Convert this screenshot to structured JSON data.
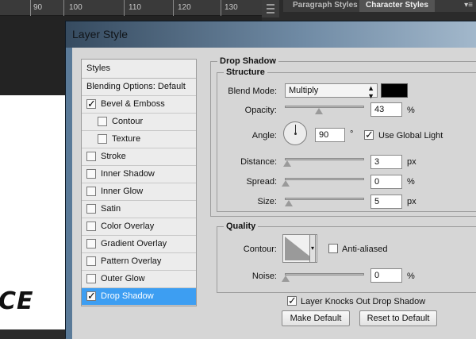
{
  "workspace": {
    "ruler_numbers": [
      "90",
      "100",
      "110",
      "120",
      "130"
    ],
    "canvas_text": "CE"
  },
  "panel": {
    "tabs": [
      "Paragraph Styles",
      "Character Styles"
    ],
    "active_tab": "Character Styles",
    "menu_icon": "panel-menu-icon"
  },
  "dialog": {
    "title": "Layer Style",
    "styles_header": "Styles",
    "blending_options": "Blending Options: Default",
    "items": [
      {
        "label": "Bevel & Emboss",
        "checked": true
      },
      {
        "label": "Contour",
        "checked": false,
        "indent": true
      },
      {
        "label": "Texture",
        "checked": false,
        "indent": true
      },
      {
        "label": "Stroke",
        "checked": false
      },
      {
        "label": "Inner Shadow",
        "checked": false
      },
      {
        "label": "Inner Glow",
        "checked": false
      },
      {
        "label": "Satin",
        "checked": false
      },
      {
        "label": "Color Overlay",
        "checked": false
      },
      {
        "label": "Gradient Overlay",
        "checked": false
      },
      {
        "label": "Pattern Overlay",
        "checked": false
      },
      {
        "label": "Outer Glow",
        "checked": false
      },
      {
        "label": "Drop Shadow",
        "checked": true,
        "selected": true
      }
    ]
  },
  "drop_shadow": {
    "section_title": "Drop Shadow",
    "structure_title": "Structure",
    "blend_mode_label": "Blend Mode:",
    "blend_mode_value": "Multiply",
    "shadow_color": "#000000",
    "opacity_label": "Opacity:",
    "opacity_value": "43",
    "opacity_unit": "%",
    "opacity_level": 43,
    "angle_label": "Angle:",
    "angle_value": "90",
    "angle_unit": "°",
    "use_global_light_label": "Use Global Light",
    "use_global_light_checked": true,
    "distance_label": "Distance:",
    "distance_value": "3",
    "distance_unit": "px",
    "spread_label": "Spread:",
    "spread_value": "0",
    "spread_unit": "%",
    "size_label": "Size:",
    "size_value": "5",
    "size_unit": "px",
    "quality_title": "Quality",
    "contour_label": "Contour:",
    "anti_aliased_label": "Anti-aliased",
    "anti_aliased_checked": false,
    "noise_label": "Noise:",
    "noise_value": "0",
    "noise_unit": "%",
    "knocks_out_label": "Layer Knocks Out Drop Shadow",
    "knocks_out_checked": true,
    "make_default_label": "Make Default",
    "reset_default_label": "Reset to Default"
  },
  "colors": {
    "selected_item_bg": "#3d9ef2",
    "dialog_bg": "#d6d6d6"
  }
}
